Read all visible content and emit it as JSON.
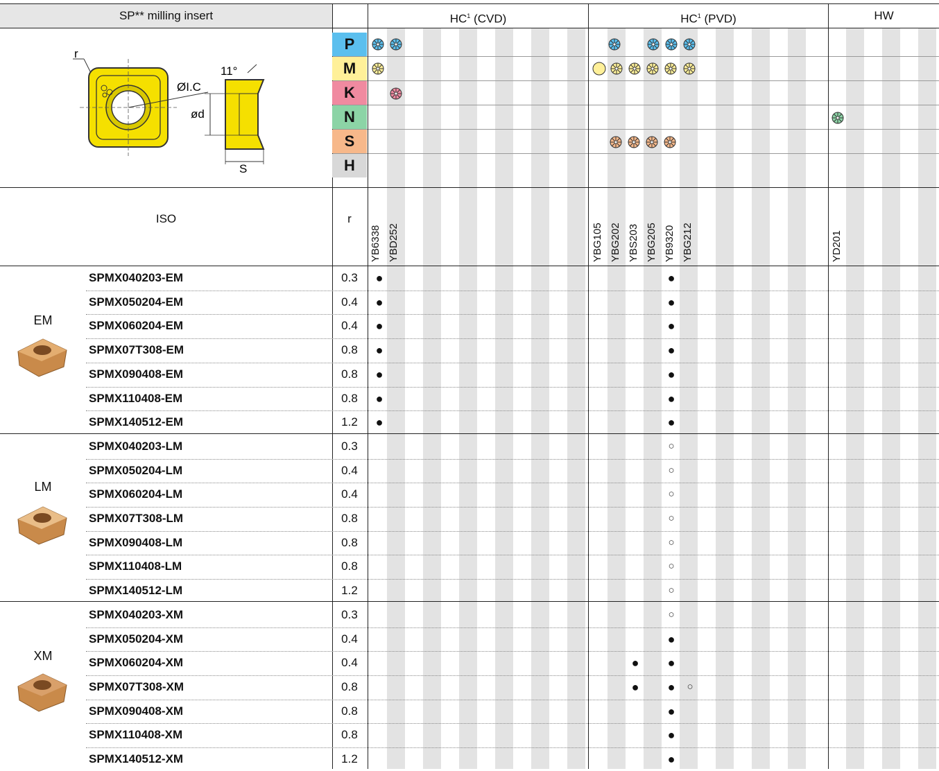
{
  "header": {
    "product": "SP** milling insert",
    "hc_cvd": "HC",
    "hc_cvd_sup": "1",
    "hc_cvd_suffix": " (CVD)",
    "hc_pvd": "HC",
    "hc_pvd_sup": "1",
    "hc_pvd_suffix": " (PVD)",
    "hw": "HW"
  },
  "drawing_labels": {
    "r": "r",
    "angle": "11°",
    "ic": "ØI.C",
    "d": "ød",
    "s": "S"
  },
  "materials": [
    {
      "letter": "P",
      "color": "#5bbfee"
    },
    {
      "letter": "M",
      "color": "#fff099"
    },
    {
      "letter": "K",
      "color": "#f08aa0"
    },
    {
      "letter": "N",
      "color": "#8cd4a6"
    },
    {
      "letter": "S",
      "color": "#f7b88a"
    },
    {
      "letter": "H",
      "color": "#d8d8d8"
    }
  ],
  "iso_label": "ISO",
  "r_label": "r",
  "grades": [
    "YB6338",
    "YBD252",
    "YBG105",
    "YBG202",
    "YBS203",
    "YBG205",
    "YB9320",
    "YBG212",
    "YD201"
  ],
  "groups": [
    {
      "name": "EM",
      "rows": [
        {
          "code": "SPMX040203-EM",
          "r": "0.3"
        },
        {
          "code": "SPMX050204-EM",
          "r": "0.4"
        },
        {
          "code": "SPMX060204-EM",
          "r": "0.4"
        },
        {
          "code": "SPMX07T308-EM",
          "r": "0.8"
        },
        {
          "code": "SPMX090408-EM",
          "r": "0.8"
        },
        {
          "code": "SPMX110408-EM",
          "r": "0.8"
        },
        {
          "code": "SPMX140512-EM",
          "r": "1.2"
        }
      ]
    },
    {
      "name": "LM",
      "rows": [
        {
          "code": "SPMX040203-LM",
          "r": "0.3"
        },
        {
          "code": "SPMX050204-LM",
          "r": "0.4"
        },
        {
          "code": "SPMX060204-LM",
          "r": "0.4"
        },
        {
          "code": "SPMX07T308-LM",
          "r": "0.8"
        },
        {
          "code": "SPMX090408-LM",
          "r": "0.8"
        },
        {
          "code": "SPMX110408-LM",
          "r": "0.8"
        },
        {
          "code": "SPMX140512-LM",
          "r": "1.2"
        }
      ]
    },
    {
      "name": "XM",
      "rows": [
        {
          "code": "SPMX040203-XM",
          "r": "0.3"
        },
        {
          "code": "SPMX050204-XM",
          "r": "0.4"
        },
        {
          "code": "SPMX060204-XM",
          "r": "0.4"
        },
        {
          "code": "SPMX07T308-XM",
          "r": "0.8"
        },
        {
          "code": "SPMX090408-XM",
          "r": "0.8"
        },
        {
          "code": "SPMX110408-XM",
          "r": "0.8"
        },
        {
          "code": "SPMX140512-XM",
          "r": "1.2"
        }
      ]
    }
  ],
  "availability": {
    "YB6338": [
      "●",
      "●",
      "●",
      "●",
      "●",
      "●",
      "●",
      "",
      "",
      "",
      "",
      "",
      "",
      "",
      "",
      "",
      "",
      "",
      "",
      "",
      ""
    ],
    "YB9320": [
      "●",
      "●",
      "●",
      "●",
      "●",
      "●",
      "●",
      "○",
      "○",
      "○",
      "○",
      "○",
      "○",
      "○",
      "○",
      "●",
      "●",
      "●",
      "●",
      "●",
      "●"
    ],
    "YBS203": [
      "",
      "",
      "",
      "",
      "",
      "",
      "",
      "",
      "",
      "",
      "",
      "",
      "",
      "",
      "",
      "",
      "●",
      "●",
      "",
      "",
      ""
    ],
    "YBG212": [
      "",
      "",
      "",
      "",
      "",
      "",
      "",
      "",
      "",
      "",
      "",
      "",
      "",
      "",
      "",
      "",
      "",
      "○",
      "",
      "",
      ""
    ]
  }
}
